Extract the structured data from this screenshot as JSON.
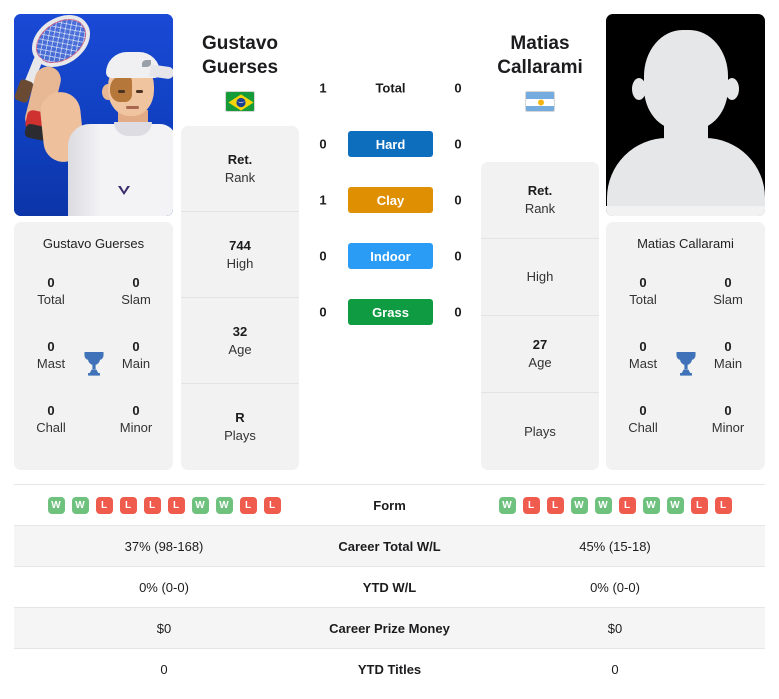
{
  "players": {
    "left": {
      "first_name": "Gustavo",
      "last_name": "Guerses",
      "full_name": "Gustavo Guerses",
      "country": "Brazil",
      "flag_icon": "brazil-flag-icon",
      "photo_type": "player-photo",
      "rank": "Ret.",
      "rank_label": "Rank",
      "high": "744",
      "high_label": "High",
      "age": "32",
      "age_label": "Age",
      "plays": "R",
      "plays_label": "Plays",
      "titles": {
        "total": "0",
        "total_label": "Total",
        "slam": "0",
        "slam_label": "Slam",
        "mast": "0",
        "mast_label": "Mast",
        "main": "0",
        "main_label": "Main",
        "chall": "0",
        "chall_label": "Chall",
        "minor": "0",
        "minor_label": "Minor"
      },
      "surface_wins": {
        "total": "1",
        "hard": "0",
        "clay": "1",
        "indoor": "0",
        "grass": "0"
      },
      "form": [
        "W",
        "W",
        "L",
        "L",
        "L",
        "L",
        "W",
        "W",
        "L",
        "L"
      ],
      "career_total_wl": "37% (98-168)",
      "ytd_wl": "0% (0-0)",
      "career_prize_money": "$0",
      "ytd_titles": "0"
    },
    "right": {
      "first_name": "Matias",
      "last_name": "Callarami",
      "full_name": "Matias Callarami",
      "country": "Argentina",
      "flag_icon": "argentina-flag-icon",
      "photo_type": "placeholder-avatar",
      "rank": "Ret.",
      "rank_label": "Rank",
      "high": "",
      "high_label": "High",
      "age": "27",
      "age_label": "Age",
      "plays": "",
      "plays_label": "Plays",
      "titles": {
        "total": "0",
        "total_label": "Total",
        "slam": "0",
        "slam_label": "Slam",
        "mast": "0",
        "mast_label": "Mast",
        "main": "0",
        "main_label": "Main",
        "chall": "0",
        "chall_label": "Chall",
        "minor": "0",
        "minor_label": "Minor"
      },
      "surface_wins": {
        "total": "0",
        "hard": "0",
        "clay": "0",
        "indoor": "0",
        "grass": "0"
      },
      "form": [
        "W",
        "L",
        "L",
        "W",
        "W",
        "L",
        "W",
        "W",
        "L",
        "L"
      ],
      "career_total_wl": "45% (15-18)",
      "ytd_wl": "0% (0-0)",
      "career_prize_money": "$0",
      "ytd_titles": "0"
    }
  },
  "surfaces": [
    {
      "key": "total",
      "label": "Total",
      "styled": false,
      "color": ""
    },
    {
      "key": "hard",
      "label": "Hard",
      "styled": true,
      "color": "#0d6ebe"
    },
    {
      "key": "clay",
      "label": "Clay",
      "styled": true,
      "color": "#df8f02"
    },
    {
      "key": "indoor",
      "label": "Indoor",
      "styled": true,
      "color": "#2b9cf5"
    },
    {
      "key": "grass",
      "label": "Grass",
      "styled": true,
      "color": "#0f9b42"
    }
  ],
  "table_rows": [
    {
      "label": "Form",
      "key": "form",
      "type": "form"
    },
    {
      "label": "Career Total W/L",
      "key": "career_total_wl",
      "type": "text"
    },
    {
      "label": "YTD W/L",
      "key": "ytd_wl",
      "type": "text"
    },
    {
      "label": "Career Prize Money",
      "key": "career_prize_money",
      "type": "text"
    },
    {
      "label": "YTD Titles",
      "key": "ytd_titles",
      "type": "text"
    }
  ],
  "colors": {
    "win_badge": "#6fc17e",
    "loss_badge": "#ef5b4c",
    "trophy": "#3f72b8",
    "panel_bg": "#f2f2f2",
    "alt_row": "#f5f5f5"
  },
  "icons": {
    "trophy": "trophy-icon"
  }
}
